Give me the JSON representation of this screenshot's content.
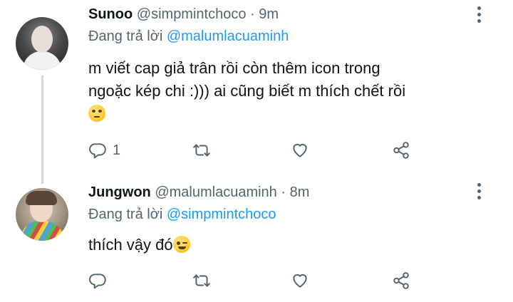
{
  "tweets": [
    {
      "display_name": "Sunoo",
      "handle": "@simpmintchoco",
      "separator": "·",
      "time": "9m",
      "reply_prefix": "Đang trả lời",
      "reply_to": "@malumlacuaminh",
      "text_line1": "m viết cap giả trân rồi còn thêm icon trong",
      "text_line2": "ngoặc kép chi :))) ai cũng biết m thích chết rồi",
      "emoji": "face-with-rolling-eyes",
      "reply_count": "1",
      "icons": [
        "reply-icon",
        "retweet-icon",
        "like-icon",
        "share-icon",
        "more-icon"
      ]
    },
    {
      "display_name": "Jungwon",
      "handle": "@malumlacuaminh",
      "separator": "·",
      "time": "8m",
      "reply_prefix": "Đang trả lời",
      "reply_to": "@simpmintchoco",
      "text": "thích vậy đó",
      "emoji": "winking-face",
      "reply_count": "",
      "icons": [
        "reply-icon",
        "retweet-icon",
        "like-icon",
        "share-icon",
        "more-icon"
      ]
    }
  ],
  "colors": {
    "link": "#1d9bf0",
    "secondary_text": "#536471",
    "thread_line": "#cfd9de"
  }
}
